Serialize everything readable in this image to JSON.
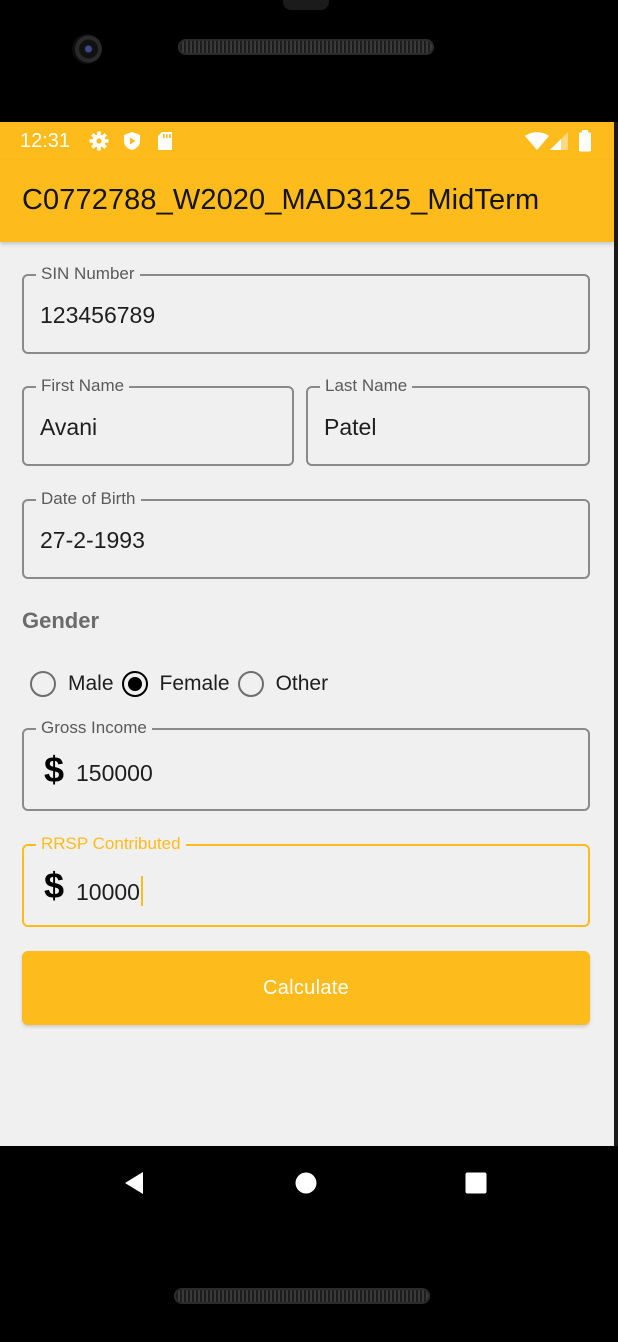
{
  "status_bar": {
    "time": "12:31",
    "left_icons": [
      "gear-icon",
      "play-protect-icon",
      "sd-card-icon"
    ],
    "right_icons": [
      "wifi-icon",
      "signal-icon",
      "battery-icon"
    ]
  },
  "app_bar": {
    "title": "C0772788_W2020_MAD3125_MidTerm"
  },
  "form": {
    "sin": {
      "label": "SIN Number",
      "value": "123456789"
    },
    "first_name": {
      "label": "First Name",
      "value": "Avani"
    },
    "last_name": {
      "label": "Last Name",
      "value": "Patel"
    },
    "dob": {
      "label": "Date of Birth",
      "value": "27-2-1993"
    },
    "gender": {
      "label": "Gender",
      "options": [
        "Male",
        "Female",
        "Other"
      ],
      "selected": "Female"
    },
    "gross_income": {
      "label": "Gross Income",
      "prefix": "$",
      "value": "150000"
    },
    "rrsp": {
      "label": "RRSP Contributed",
      "prefix": "$",
      "value": "10000",
      "focused": true
    },
    "calculate_label": "Calculate"
  },
  "nav_bar": {
    "buttons": [
      "back-icon",
      "home-icon",
      "recents-icon"
    ]
  },
  "colors": {
    "accent": "#fdbb1c",
    "background": "#f0f0f0",
    "outline": "#8a8a8a"
  }
}
